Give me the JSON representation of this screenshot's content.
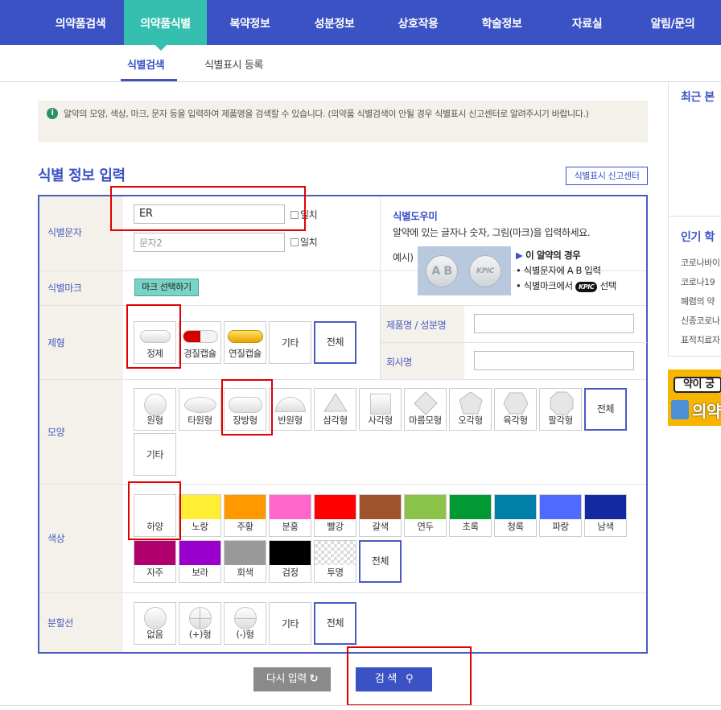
{
  "nav": {
    "items": [
      "의약품검색",
      "의약품식별",
      "복약정보",
      "성분정보",
      "상호작용",
      "학술정보",
      "자료실",
      "알림/문의"
    ]
  },
  "subnav": {
    "items": [
      "식별검색",
      "식별표시 등록"
    ]
  },
  "notice": {
    "text": "알약의 모양, 색상, 마크, 문자 등을 입력하여 제품명을 검색할 수 있습니다. (의약품 식별검색이 안될 경우 식별표시 신고센터로 알려주시기 바랍니다.)"
  },
  "section": {
    "title": "식별 정보 입력",
    "report_btn": "식별표시 신고센터"
  },
  "labels": {
    "text": "식별문자",
    "mark": "식별마크",
    "form": "제형",
    "shape": "모양",
    "color": "색상",
    "line": "분할선",
    "product": "제품명 / 성분명",
    "company": "회사명"
  },
  "inputs": {
    "text1_value": "ER",
    "text2_placeholder": "문자2",
    "exact": "일치"
  },
  "mark_btn": "마크 선택하기",
  "help": {
    "title": "식별도우미",
    "desc": "알약에 있는 글자나 숫자, 그림(마크)을 입력하세요.",
    "example": "예시)",
    "img_ab": "A B",
    "img_kpic": "KPIC",
    "case": "이 알약의 경우",
    "line1": "식별문자에 A B 입력",
    "line2_pre": "식별마크에서",
    "line2_badge": "KPIC",
    "line2_post": "선택"
  },
  "forms": [
    "정제",
    "경질캡슐",
    "연질캡슐",
    "기타",
    "전체"
  ],
  "shapes": [
    "원형",
    "타원형",
    "장방형",
    "반원형",
    "삼각형",
    "사각형",
    "마름모형",
    "오각형",
    "육각형",
    "팔각형",
    "전체",
    "기타"
  ],
  "colors": [
    {
      "name": "하양",
      "hex": "#ffffff"
    },
    {
      "name": "노랑",
      "hex": "#ffee33"
    },
    {
      "name": "주황",
      "hex": "#ff9900"
    },
    {
      "name": "분홍",
      "hex": "#ff66cc"
    },
    {
      "name": "빨강",
      "hex": "#ff0000"
    },
    {
      "name": "갈색",
      "hex": "#a0522d"
    },
    {
      "name": "연두",
      "hex": "#8bc34a"
    },
    {
      "name": "초록",
      "hex": "#009933"
    },
    {
      "name": "청록",
      "hex": "#0080a8"
    },
    {
      "name": "파랑",
      "hex": "#4f6bff"
    },
    {
      "name": "남색",
      "hex": "#1428a0"
    },
    {
      "name": "자주",
      "hex": "#b0006e"
    },
    {
      "name": "보라",
      "hex": "#9900cc"
    },
    {
      "name": "회색",
      "hex": "#999999"
    },
    {
      "name": "검정",
      "hex": "#000000"
    },
    {
      "name": "투명",
      "hex": "transparent"
    }
  ],
  "color_all": "전체",
  "lines": [
    "없음",
    "(+)형",
    "(-)형",
    "기타",
    "전체"
  ],
  "actions": {
    "reset": "다시 입력",
    "search": "검 색"
  },
  "side": {
    "recent": "최근 본",
    "popular": "인기 학",
    "items": [
      "코로나바이",
      "코로나19",
      "폐렴의 약",
      "신종코로나",
      "표적치료자"
    ],
    "banner_top": "약이 궁",
    "banner_bot": "의약"
  }
}
